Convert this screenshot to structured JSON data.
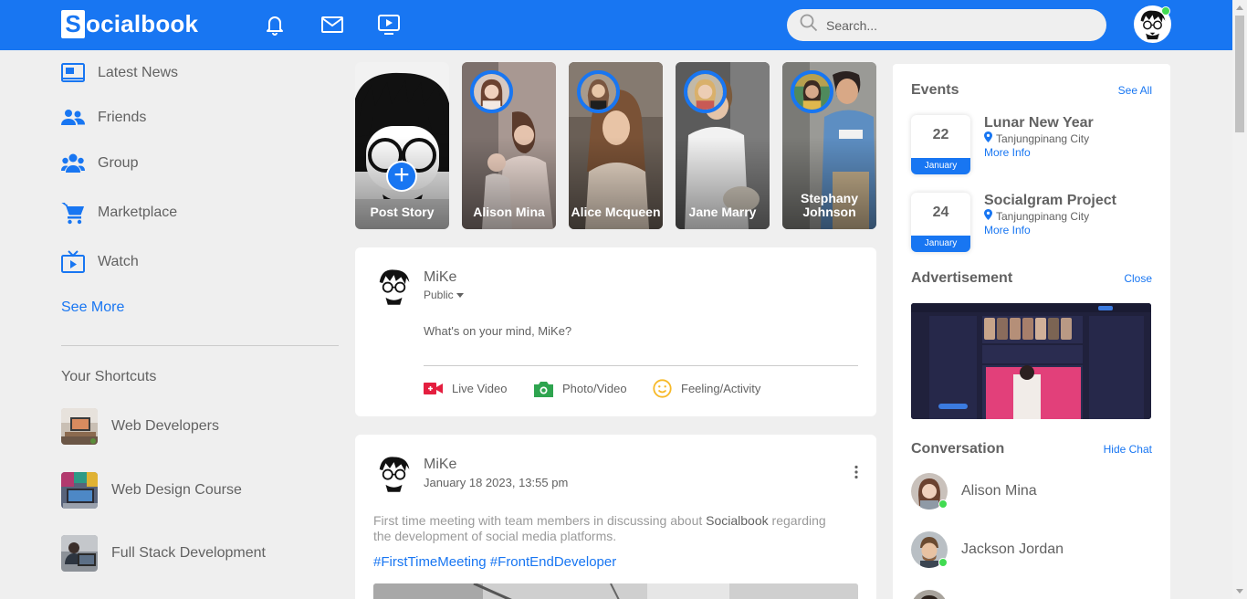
{
  "brand": {
    "logo_letter": "S",
    "logo_rest": "ocialbook",
    "color": "#1876f2"
  },
  "navbar": {
    "icons": [
      "bell-icon",
      "mail-icon",
      "video-icon"
    ],
    "search_placeholder": "Search...",
    "online_color": "#41db51"
  },
  "sidebar": {
    "items": [
      {
        "label": "Latest News",
        "icon": "news-icon"
      },
      {
        "label": "Friends",
        "icon": "friends-icon"
      },
      {
        "label": "Group",
        "icon": "group-icon"
      },
      {
        "label": "Marketplace",
        "icon": "cart-icon"
      },
      {
        "label": "Watch",
        "icon": "tv-icon"
      }
    ],
    "see_more": "See More",
    "shortcuts_title": "Your Shortcuts",
    "shortcuts": [
      {
        "label": "Web Developers"
      },
      {
        "label": "Web Design Course"
      },
      {
        "label": "Full Stack Development"
      }
    ]
  },
  "stories": [
    {
      "name": "Post Story"
    },
    {
      "name": "Alison Mina"
    },
    {
      "name": "Alice Mcqueen"
    },
    {
      "name": "Jane Marry"
    },
    {
      "name": "Stephany Johnson"
    }
  ],
  "composer": {
    "user": "MiKe",
    "visibility": "Public",
    "placeholder": "What's on your mind, MiKe?",
    "actions": [
      {
        "label": "Live Video",
        "icon": "live-video-icon",
        "color": "#e41e3f"
      },
      {
        "label": "Photo/Video",
        "icon": "photo-icon",
        "color": "#2ea44f"
      },
      {
        "label": "Feeling/Activity",
        "icon": "smile-icon",
        "color": "#f7b928"
      }
    ]
  },
  "post": {
    "user": "MiKe",
    "date": "January 18 2023, 13:55 pm",
    "text_before": "First time meeting with team members in discussing about ",
    "text_bold": "Socialbook",
    "text_after": " regarding the development of social media platforms.",
    "hashtags": "#FirstTimeMeeting #FrontEndDeveloper"
  },
  "events": {
    "title": "Events",
    "see_all": "See All",
    "items": [
      {
        "day": "22",
        "month": "January",
        "title": "Lunar New Year",
        "location": "Tanjungpinang City",
        "more": "More Info"
      },
      {
        "day": "24",
        "month": "January",
        "title": "Socialgram Project",
        "location": "Tanjungpinang City",
        "more": "More Info"
      }
    ]
  },
  "advertisement": {
    "title": "Advertisement",
    "close": "Close"
  },
  "conversation": {
    "title": "Conversation",
    "hide": "Hide Chat",
    "contacts": [
      {
        "name": "Alison Mina"
      },
      {
        "name": "Jackson Jordan"
      }
    ]
  }
}
